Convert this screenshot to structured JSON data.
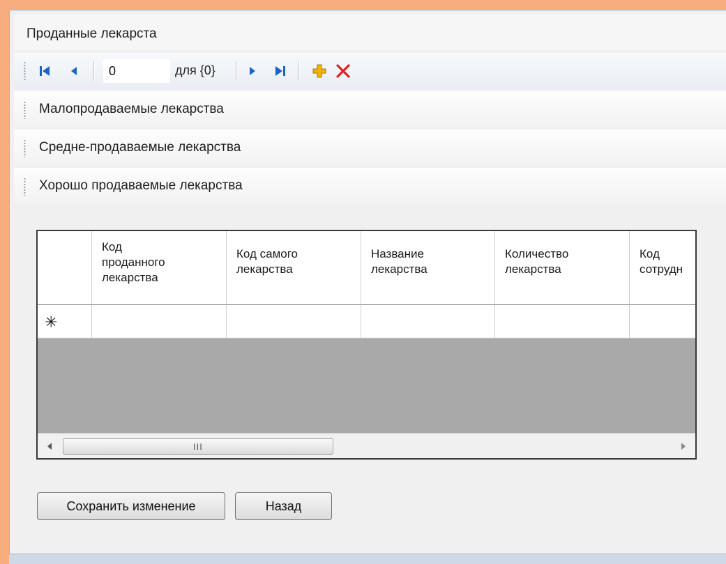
{
  "form": {
    "title": "Проданные лекарста"
  },
  "navigator": {
    "position": "0",
    "count_label": "для {0}"
  },
  "sections": [
    {
      "label": "Малопродаваемые лекарства"
    },
    {
      "label": "Средне-продаваемые лекарства"
    },
    {
      "label": "Хорошо продаваемые лекарства"
    }
  ],
  "grid": {
    "columns": [
      {
        "line1": "Код",
        "line2": "проданного",
        "line3": "лекарства"
      },
      {
        "line1": "Код самого",
        "line2": "лекарства",
        "line3": ""
      },
      {
        "line1": "Название",
        "line2": "лекарства",
        "line3": ""
      },
      {
        "line1": "Количество",
        "line2": "лекарства",
        "line3": ""
      },
      {
        "line1": "Код",
        "line2": "сотрудн",
        "line3": ""
      }
    ],
    "new_row_marker": "✳",
    "scroll_grip": "III"
  },
  "buttons": {
    "save_label": "Сохранить изменение",
    "back_label": "Назад"
  },
  "colors": {
    "background": "#f8ad7e",
    "nav_icon": "#1a64c8",
    "add_icon": "#f0b400",
    "delete_icon": "#e02020"
  }
}
